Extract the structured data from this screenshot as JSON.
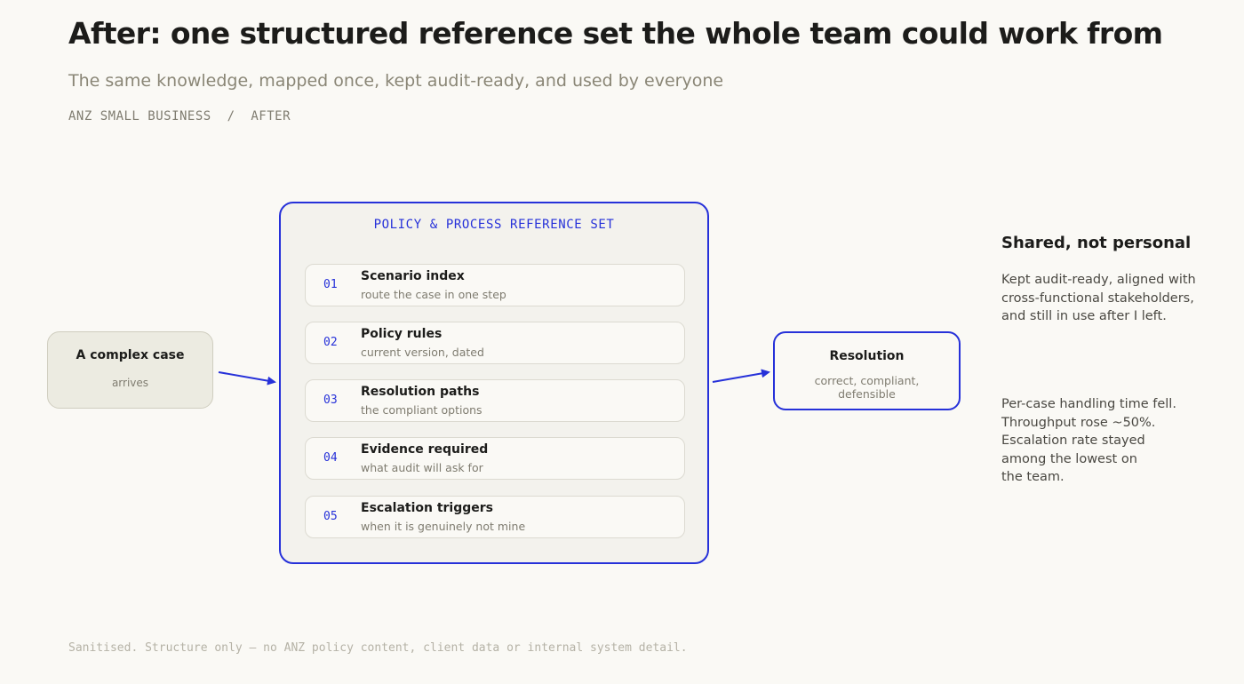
{
  "header": {
    "title": "After: one structured reference set the whole team could work from",
    "subtitle": "The same knowledge, mapped once, kept audit-ready, and used by everyone",
    "breadcrumb": "ANZ SMALL BUSINESS  /  AFTER"
  },
  "diagram": {
    "input": {
      "title": "A complex case",
      "subtitle": "arrives"
    },
    "reference_set": {
      "title": "POLICY & PROCESS REFERENCE SET",
      "items": [
        {
          "num": "01",
          "name": "Scenario index",
          "desc": "route the case in one step"
        },
        {
          "num": "02",
          "name": "Policy rules",
          "desc": "current version, dated"
        },
        {
          "num": "03",
          "name": "Resolution paths",
          "desc": "the compliant options"
        },
        {
          "num": "04",
          "name": "Evidence required",
          "desc": "what audit will ask for"
        },
        {
          "num": "05",
          "name": "Escalation triggers",
          "desc": "when it is genuinely not mine"
        }
      ]
    },
    "output": {
      "title": "Resolution",
      "subtitle": "correct, compliant, defensible"
    },
    "accent_color": "#2631d9"
  },
  "sidebar": {
    "heading": "Shared, not personal",
    "paragraph1": "Kept audit-ready, aligned with cross-functional stakeholders, and still in use after I left.",
    "paragraph2_lines": [
      "Per-case handling time fell.",
      "Throughput rose ~50%.",
      "Escalation rate stayed",
      "among the lowest on",
      "the team."
    ]
  },
  "footer": {
    "note": "Sanitised. Structure only — no ANZ policy content, client data or internal system detail."
  }
}
